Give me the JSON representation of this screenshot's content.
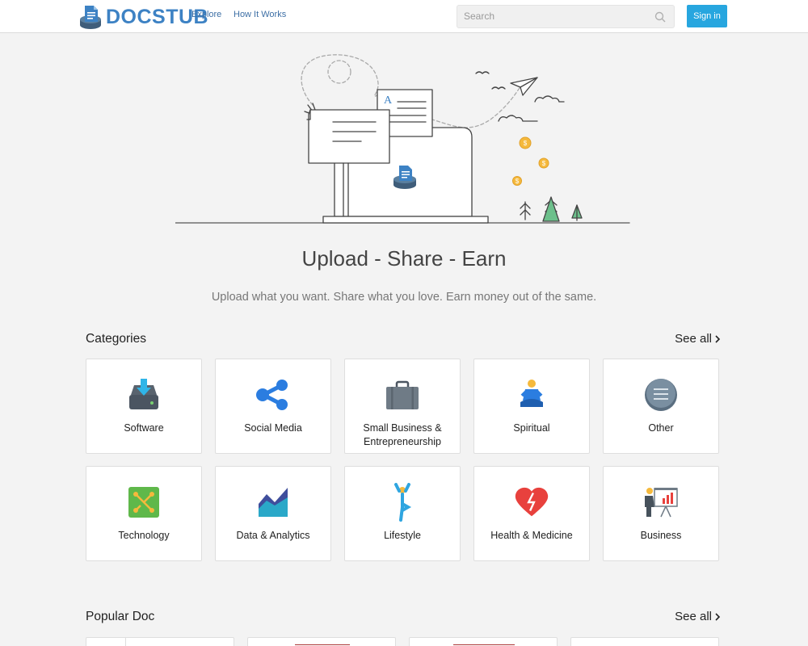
{
  "header": {
    "logo_text": "DOCSTUB",
    "nav": [
      "Explore",
      "How It Works"
    ],
    "search_placeholder": "Search",
    "signin_label": "Sign in"
  },
  "hero": {
    "title": "Upload - Share - Earn",
    "subtitle": "Upload what you want. Share what you love. Earn money out of the same.",
    "illustration_letter": "A"
  },
  "categories": {
    "title": "Categories",
    "see_all": "See all",
    "items": [
      {
        "label": "Software",
        "icon": "download-drive-icon"
      },
      {
        "label": "Social Media",
        "icon": "share-icon"
      },
      {
        "label": "Small Business & Entrepreneurship",
        "icon": "briefcase-icon"
      },
      {
        "label": "Spiritual",
        "icon": "meditation-icon"
      },
      {
        "label": "Other",
        "icon": "menu-circle-icon"
      },
      {
        "label": "Technology",
        "icon": "circuit-icon"
      },
      {
        "label": "Data & Analytics",
        "icon": "area-chart-icon"
      },
      {
        "label": "Lifestyle",
        "icon": "yoga-pose-icon"
      },
      {
        "label": "Health & Medicine",
        "icon": "broken-heart-icon"
      },
      {
        "label": "Business",
        "icon": "presentation-icon"
      }
    ]
  },
  "popular": {
    "title": "Popular Doc",
    "see_all": "See all"
  },
  "colors": {
    "accent": "#27a6df",
    "logo": "#3d82c4",
    "background": "#f3f3f3"
  }
}
